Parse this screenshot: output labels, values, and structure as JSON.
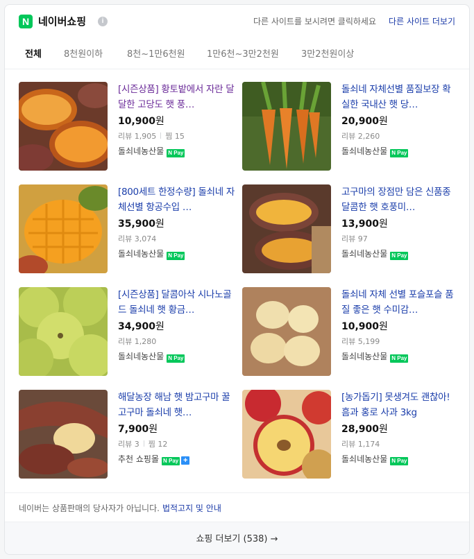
{
  "header": {
    "logo_letter": "N",
    "brand": "네이버쇼핑",
    "info_icon_glyph": "i",
    "hint": "다른 사이트를 보시려면 클릭하세요",
    "other_sites_link": "다른 사이트 더보기"
  },
  "tabs": [
    {
      "label": "전체",
      "active": true
    },
    {
      "label": "8천원이하",
      "active": false
    },
    {
      "label": "8천~1만6천원",
      "active": false
    },
    {
      "label": "1만6천~3만2천원",
      "active": false
    },
    {
      "label": "3만2천원이상",
      "active": false
    }
  ],
  "products": [
    {
      "title": "[시즌상품] 황토밭에서 자란 달달한 고당도 햇 풍…",
      "price": "10,900",
      "won": "원",
      "review_label": "리뷰",
      "review_count": "1,905",
      "zzim_label": "찜",
      "zzim_count": "15",
      "seller": "돌쇠네농산물",
      "image": "sweet-potato-halves",
      "visited": true
    },
    {
      "title": "돌쇠네 자체선별 품질보장 확실한 국내산 햇 당…",
      "price": "20,900",
      "won": "원",
      "review_label": "리뷰",
      "review_count": "2,260",
      "zzim_label": "",
      "zzim_count": "",
      "seller": "돌쇠네농산물",
      "image": "carrots",
      "visited": false
    },
    {
      "title": "[800세트 한정수량] 돌쇠네 자체선별 항공수입 …",
      "price": "35,900",
      "won": "원",
      "review_label": "리뷰",
      "review_count": "3,074",
      "zzim_label": "",
      "zzim_count": "",
      "seller": "돌쇠네농산물",
      "image": "mango",
      "visited": false
    },
    {
      "title": "고구마의 장점만 담은 신품종 달콤한 햇 호풍미…",
      "price": "13,900",
      "won": "원",
      "review_label": "리뷰",
      "review_count": "97",
      "zzim_label": "",
      "zzim_count": "",
      "seller": "돌쇠네농산물",
      "image": "roasted-sweet-potato",
      "visited": false
    },
    {
      "title": "[시즌상품] 달콤아삭 시나노골드 돌쇠네 햇 황금…",
      "price": "34,900",
      "won": "원",
      "review_label": "리뷰",
      "review_count": "1,280",
      "zzim_label": "",
      "zzim_count": "",
      "seller": "돌쇠네농산물",
      "image": "green-apples",
      "visited": false
    },
    {
      "title": "돌쇠네 자체 선별 포슬포슬 품질 좋은 햇 수미감…",
      "price": "10,900",
      "won": "원",
      "review_label": "리뷰",
      "review_count": "5,199",
      "zzim_label": "",
      "zzim_count": "",
      "seller": "돌쇠네농산물",
      "image": "potatoes",
      "visited": false
    },
    {
      "title": "해달농장 해남 햇 밤고구마 꿀고구마 돌쇠네 햇…",
      "price": "7,900",
      "won": "원",
      "review_label": "리뷰",
      "review_count": "3",
      "zzim_label": "찜",
      "zzim_count": "12",
      "seller": "추천 쇼핑몰",
      "plus": true,
      "image": "cut-sweet-potato",
      "visited": false
    },
    {
      "title": "[농가돕기] 못생겨도 괜찮아! 흠과 홍로 사과 3kg",
      "price": "28,900",
      "won": "원",
      "review_label": "리뷰",
      "review_count": "1,174",
      "zzim_label": "",
      "zzim_count": "",
      "seller": "돌쇠네농산물",
      "image": "red-apple-halves",
      "visited": false
    }
  ],
  "npay_label": "N Pay",
  "plus_glyph": "+",
  "footer": {
    "disclaimer": "네이버는 상품판매의 당사자가 아닙니다.",
    "disclaimer_link": "법적고지 및 안내",
    "more_button": "쇼핑 더보기 (538)",
    "more_arrow": "→"
  },
  "colors": {
    "naver_green": "#03c75a",
    "link_blue": "#1a3daa",
    "visited_purple": "#6a2a98",
    "plus_blue": "#2a8ff7"
  }
}
